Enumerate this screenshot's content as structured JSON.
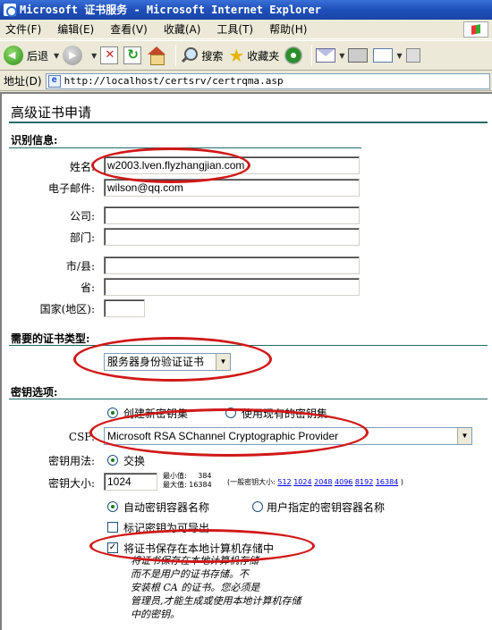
{
  "window": {
    "title": "Microsoft 证书服务 - Microsoft Internet Explorer"
  },
  "menu": [
    "文件(F)",
    "编辑(E)",
    "查看(V)",
    "收藏(A)",
    "工具(T)",
    "帮助(H)"
  ],
  "toolbar": {
    "back": "后退",
    "search": "搜索",
    "favorites": "收藏夹"
  },
  "address": {
    "label": "地址(D)",
    "url": "http://localhost/certsrv/certrqma.asp"
  },
  "page": {
    "title": "高级证书申请",
    "identity": {
      "heading": "识别信息:",
      "name_label": "姓名:",
      "name_value": "w2003.lven.flyzhangjian.com",
      "email_label": "电子邮件:",
      "email_value": "wilson@qq.com",
      "company_label": "公司:",
      "company_value": "",
      "dept_label": "部门:",
      "dept_value": "",
      "city_label": "市/县:",
      "city_value": "",
      "state_label": "省:",
      "state_value": "",
      "country_label": "国家(地区):",
      "country_value": ""
    },
    "cert_type": {
      "heading": "需要的证书类型:",
      "selected": "服务器身份验证证书"
    },
    "key_options": {
      "heading": "密钥选项:",
      "create_new": "创建新密钥集",
      "use_existing": "使用现有的密钥集",
      "csp_label": "CSP:",
      "csp_value": "Microsoft RSA SChannel Cryptographic Provider",
      "usage_label": "密钥用法:",
      "usage_value": "交换",
      "size_label": "密钥大小:",
      "size_value": "1024",
      "min_label": "最小值:",
      "min_value": "384",
      "max_label": "最大值:",
      "max_value": "16384",
      "common_prefix": "(一般密钥大小:",
      "common_sizes": [
        "512",
        "1024",
        "2048",
        "4096",
        "8192",
        "16384"
      ],
      "common_suffix": ")",
      "auto_container": "自动密钥容器名称",
      "user_container": "用户指定的密钥容器名称",
      "exportable": "标记密钥为可导出",
      "store_local": "将证书保存在本地计算机存储中",
      "store_note_lines": [
        "将证书保存在本地计算机存储",
        "而不是用户的证书存储。不",
        "安装根 CA 的证书。您必须是",
        "管理员,才能生成或使用本地计算机存储",
        "中的密钥。"
      ]
    }
  }
}
